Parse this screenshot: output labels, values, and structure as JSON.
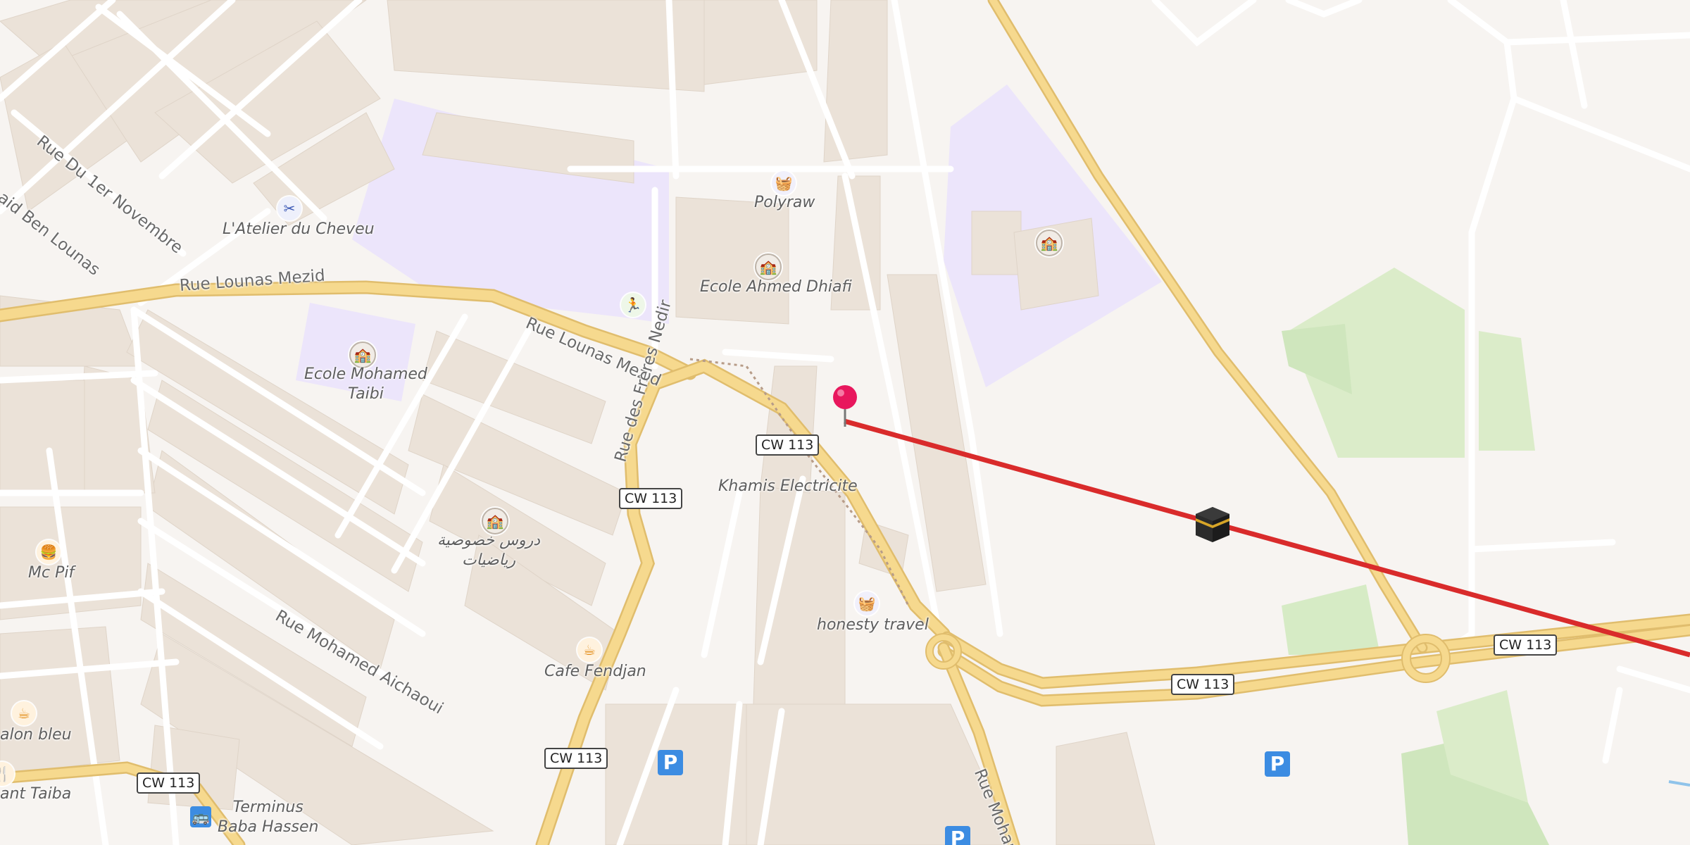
{
  "map": {
    "streets": [
      {
        "id": "rue-lounas-mezid-1",
        "text": "Rue Lounas Mezid"
      },
      {
        "id": "rue-lounas-mezid-2",
        "text": "Rue Lounas Mezid"
      },
      {
        "id": "rue-du-1er-novembre",
        "text": "Rue Du 1er Novembre"
      },
      {
        "id": "rue-said-ben-lounas",
        "text": "aid Ben Lounas"
      },
      {
        "id": "rue-des-freres-nedir",
        "text": "Rue des Freres Nedir"
      },
      {
        "id": "rue-mohamed-aichaoui",
        "text": "Rue Mohamed Aichaoui"
      },
      {
        "id": "rue-moham",
        "text": "Rue Moham"
      }
    ],
    "road_shields": [
      "CW 113",
      "CW 113",
      "CW 113",
      "CW 113",
      "CW 113",
      "CW 113"
    ],
    "pois": [
      {
        "name": "L'Atelier du Cheveu",
        "icon": "scissors-icon"
      },
      {
        "name": "Polyraw",
        "icon": "shopping-basket-icon"
      },
      {
        "name": "Ecole Ahmed Dhiafi",
        "icon": "school-icon"
      },
      {
        "name": "Ecole Mohamed\nTaibi",
        "icon": "school-icon"
      },
      {
        "name": "Khamis Electricite",
        "icon": ""
      },
      {
        "name": "دروس خصوصية\nرياضيات",
        "icon": "school-icon"
      },
      {
        "name": "Mc Pif",
        "icon": "burger-icon"
      },
      {
        "name": "honesty travel",
        "icon": "shopping-basket-icon"
      },
      {
        "name": "Cafe Fendjan",
        "icon": "cafe-icon"
      },
      {
        "name": "alon bleu",
        "icon": "cafe-icon"
      },
      {
        "name": "ant Taiba",
        "icon": "restaurant-icon"
      },
      {
        "name": "Terminus\nBaba Hassen",
        "icon": "bus-icon"
      }
    ],
    "unlabeled_icons": [
      "sport-icon",
      "school-icon"
    ],
    "parking_label": "P",
    "colors": {
      "background": "#f7f4f1",
      "building": "#e9e0d6",
      "road_major": "#f6d98e",
      "road_minor": "#ffffff",
      "school_area": "#ece5fb",
      "park": "#d8ebca",
      "route_line": "#d92b2b",
      "pin": "#e8175d",
      "parking": "#3c8ce2"
    },
    "markers": {
      "current_location": "location-pin-icon",
      "destination": "kaaba-icon"
    }
  }
}
